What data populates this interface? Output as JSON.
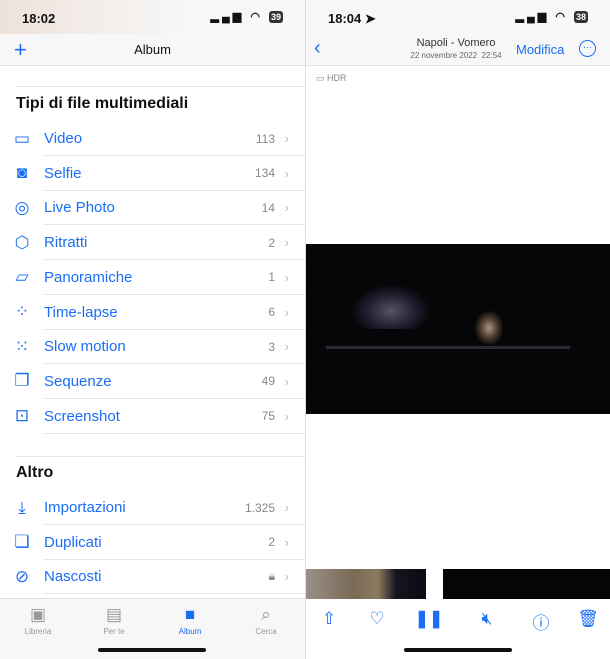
{
  "left": {
    "status": {
      "time": "18:02",
      "battery": "39"
    },
    "nav": {
      "add_icon": "plus-icon",
      "title": "Album"
    },
    "media_section": {
      "title": "Tipi di file multimediali",
      "items": [
        {
          "label": "Video",
          "count": "113",
          "icon": "video-icon"
        },
        {
          "label": "Selfie",
          "count": "134",
          "icon": "selfie-icon"
        },
        {
          "label": "Live Photo",
          "count": "14",
          "icon": "live-photo-icon"
        },
        {
          "label": "Ritratti",
          "count": "2",
          "icon": "cube-icon"
        },
        {
          "label": "Panoramiche",
          "count": "1",
          "icon": "panorama-icon"
        },
        {
          "label": "Time-lapse",
          "count": "6",
          "icon": "timelapse-icon"
        },
        {
          "label": "Slow motion",
          "count": "3",
          "icon": "slowmo-icon"
        },
        {
          "label": "Sequenze",
          "count": "49",
          "icon": "burst-icon"
        },
        {
          "label": "Screenshot",
          "count": "75",
          "icon": "screenshot-icon"
        }
      ]
    },
    "other_section": {
      "title": "Altro",
      "items": [
        {
          "label": "Importazioni",
          "count": "1.325",
          "icon": "import-icon"
        },
        {
          "label": "Duplicati",
          "count": "2",
          "icon": "duplicate-icon"
        },
        {
          "label": "Nascosti",
          "count": "",
          "icon": "eye-slash-icon",
          "locked": true
        }
      ]
    },
    "tabs": [
      {
        "label": "Libreria"
      },
      {
        "label": "Per te"
      },
      {
        "label": "Album",
        "active": true
      },
      {
        "label": "Cerca"
      }
    ]
  },
  "right": {
    "status": {
      "time": "18:04",
      "battery": "38"
    },
    "nav": {
      "title": "Napoli - Vomero",
      "subtitle": "22 novembre 2022  22:54",
      "edit": "Modifica"
    },
    "badge": "HDR"
  },
  "colors": {
    "accent": "#1a6ef5"
  }
}
